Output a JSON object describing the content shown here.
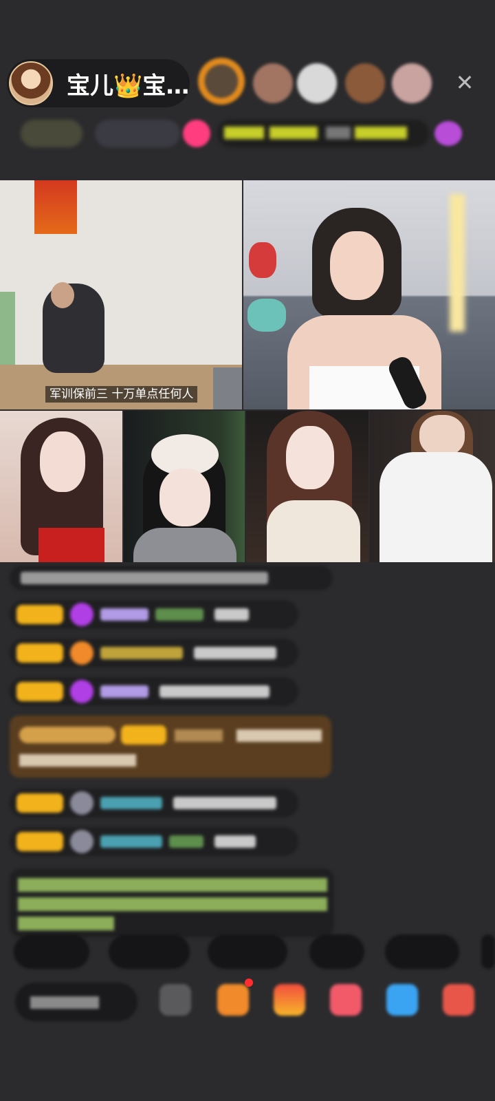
{
  "host": {
    "name": "宝儿👑宝…"
  },
  "video": {
    "main_caption": "军训保前三 十万单点任何人"
  },
  "icons": {
    "close": "close-icon",
    "host_avatar": "avatar",
    "gift": "gift-icon"
  },
  "colors": {
    "background": "#2b2b2d",
    "badge": "#f2b21b",
    "accent_pink": "#ff3d7f"
  }
}
